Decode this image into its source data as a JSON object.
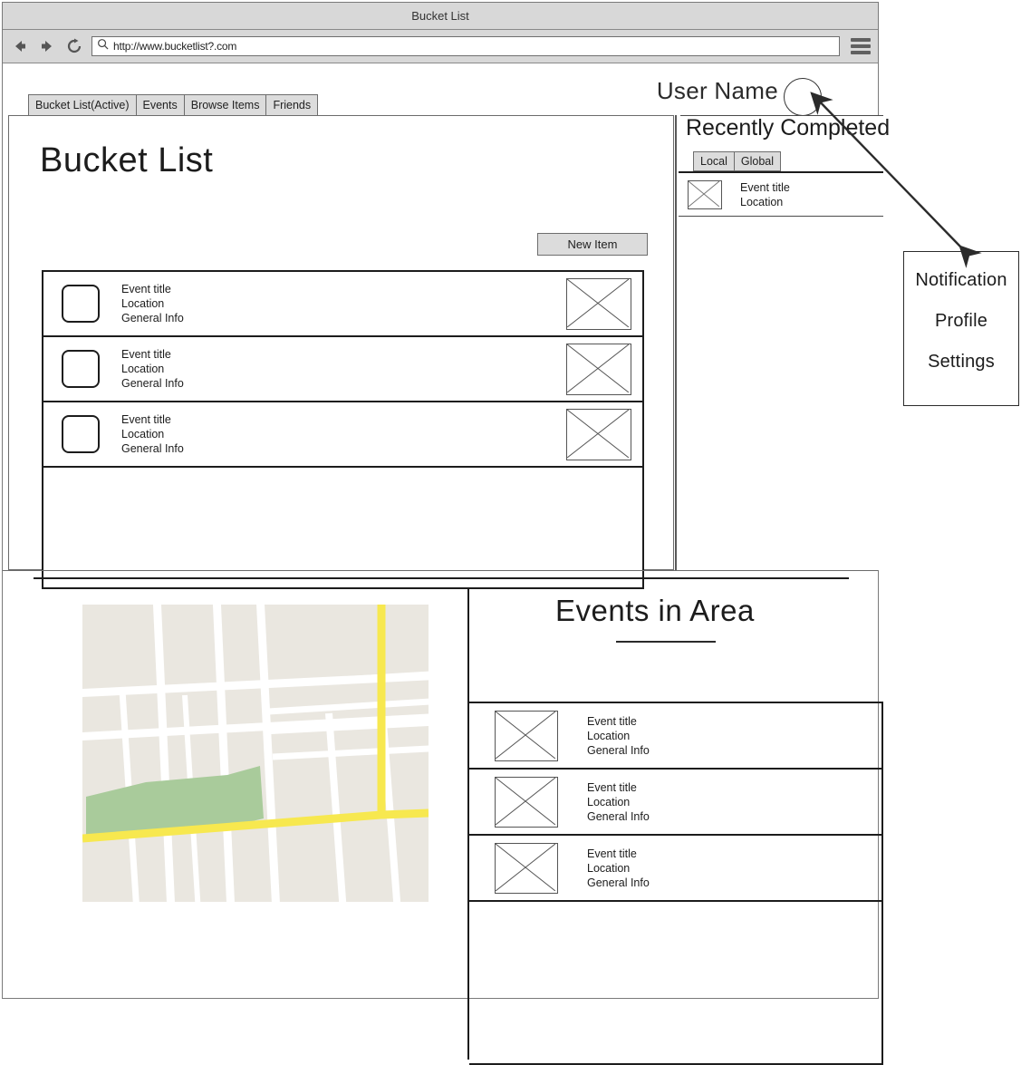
{
  "window": {
    "title": "Bucket List"
  },
  "browser": {
    "back_icon": "back-arrow-icon",
    "forward_icon": "forward-arrow-icon",
    "reload_icon": "reload-icon",
    "search_icon": "search-icon",
    "url": "http://www.bucketlist?.com",
    "menu_icon": "hamburger-menu-icon"
  },
  "nav": {
    "tabs": [
      {
        "label": "Bucket List(Active)",
        "active": true
      },
      {
        "label": "Events",
        "active": false
      },
      {
        "label": "Browse Items",
        "active": false
      },
      {
        "label": "Friends",
        "active": false
      }
    ]
  },
  "user": {
    "name": "User Name",
    "avatar": "avatar-circle-icon"
  },
  "main": {
    "title": "Bucket List",
    "new_item_label": "New Item",
    "items": [
      {
        "title": "Event title",
        "location": "Location",
        "info": "General Info"
      },
      {
        "title": "Event title",
        "location": "Location",
        "info": "General Info"
      },
      {
        "title": "Event title",
        "location": "Location",
        "info": "General Info"
      }
    ]
  },
  "sidebar": {
    "title": "Recently Completed",
    "tabs": [
      {
        "label": "Local",
        "active": true
      },
      {
        "label": "Global",
        "active": false
      }
    ],
    "items": [
      {
        "title": "Event title",
        "location": "Location"
      }
    ]
  },
  "dropdown": {
    "items": [
      {
        "label": "Notification"
      },
      {
        "label": "Profile"
      },
      {
        "label": "Settings"
      }
    ]
  },
  "events_area": {
    "title": "Events in Area",
    "items": [
      {
        "title": "Event title",
        "location": "Location",
        "info": "General Info"
      },
      {
        "title": "Event title",
        "location": "Location",
        "info": "General Info"
      },
      {
        "title": "Event title",
        "location": "Location",
        "info": "General Info"
      }
    ]
  },
  "map": {
    "background_color": "#eae7e0",
    "street_color": "#ffffff",
    "highway_color": "#f7e84f",
    "park_color": "#a9cb9b"
  }
}
